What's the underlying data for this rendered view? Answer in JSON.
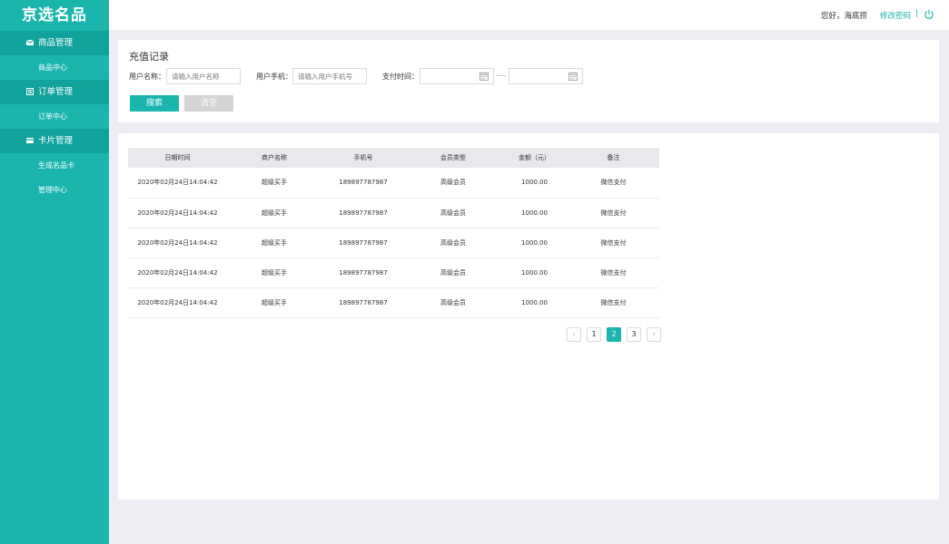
{
  "app": {
    "logo": "京选名品"
  },
  "sidebar": {
    "groups": [
      {
        "label": "商品管理",
        "icon": "mail-icon",
        "items": [
          {
            "label": "商品中心"
          }
        ]
      },
      {
        "label": "订单管理",
        "icon": "list-icon",
        "items": [
          {
            "label": "订单中心"
          }
        ]
      },
      {
        "label": "卡片管理",
        "icon": "card-icon",
        "items": [
          {
            "label": "生成名品卡"
          },
          {
            "label": "管理中心"
          }
        ]
      }
    ]
  },
  "header": {
    "greeting": "您好，海底捞",
    "change_password": "修改密码",
    "separator": "|",
    "power_icon": "power-icon"
  },
  "search": {
    "title": "充值记录",
    "user_name_label": "用户名称：",
    "user_name_placeholder": "请输入用户名称",
    "user_phone_label": "用户手机：",
    "user_phone_placeholder": "请输入用户手机号",
    "pay_time_label": "支付时间：",
    "search_button": "搜索",
    "clear_button": "清空"
  },
  "table": {
    "columns": [
      "日期时间",
      "商户名称",
      "手机号",
      "会员类型",
      "金额（元）",
      "备注"
    ],
    "rows": [
      [
        "2020年02月24日14:04:42",
        "超级买手",
        "189897787987",
        "高级会员",
        "1000.00",
        "微信支付"
      ],
      [
        "2020年02月24日14:04:42",
        "超级买手",
        "189897787987",
        "高级会员",
        "1000.00",
        "微信支付"
      ],
      [
        "2020年02月24日14:04:42",
        "超级买手",
        "189897787987",
        "高级会员",
        "1000.00",
        "微信支付"
      ],
      [
        "2020年02月24日14:04:42",
        "超级买手",
        "189897787987",
        "高级会员",
        "1000.00",
        "微信支付"
      ],
      [
        "2020年02月24日14:04:42",
        "超级买手",
        "189897787987",
        "高级会员",
        "1000.00",
        "微信支付"
      ]
    ]
  },
  "pagination": {
    "prev": "‹",
    "pages": [
      "1",
      "2",
      "3"
    ],
    "current": "2",
    "next": "›"
  },
  "colors": {
    "accent": "#1ab5ac",
    "accent_dark": "#11a39b",
    "background": "#ebedf2"
  }
}
